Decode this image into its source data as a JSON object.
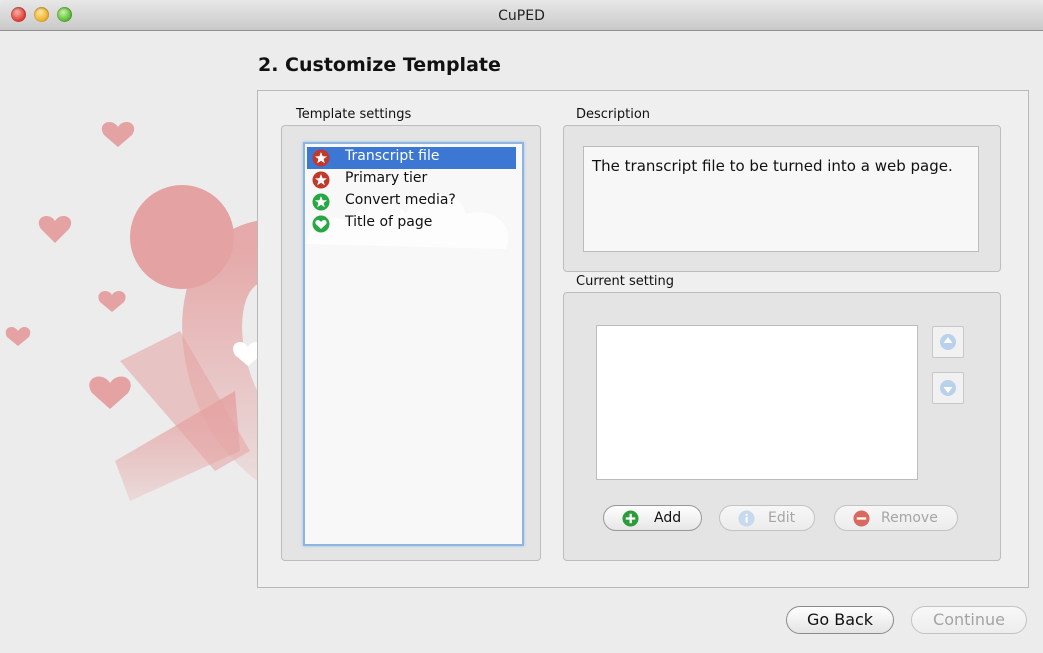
{
  "window": {
    "title": "CuPED"
  },
  "page": {
    "title": "2. Customize Template"
  },
  "template_settings": {
    "label": "Template settings",
    "items": [
      {
        "label": "Transcript file",
        "icon": "star-badge-icon",
        "color": "#c0392b",
        "selected": true
      },
      {
        "label": "Primary tier",
        "icon": "star-badge-icon",
        "color": "#c0392b",
        "selected": false
      },
      {
        "label": "Convert media?",
        "icon": "star-badge-icon",
        "color": "#27a844",
        "selected": false
      },
      {
        "label": "Title of page",
        "icon": "heart-badge-icon",
        "color": "#27a844",
        "selected": false
      }
    ]
  },
  "description": {
    "label": "Description",
    "text": "The transcript file to be turned into a web page."
  },
  "current_setting": {
    "label": "Current setting",
    "buttons": {
      "add": "Add",
      "edit": "Edit",
      "remove": "Remove"
    }
  },
  "footer": {
    "back": "Go Back",
    "continue": "Continue"
  },
  "colors": {
    "accent": "#3c77d4",
    "heart_pink": "#e5a2a2"
  }
}
